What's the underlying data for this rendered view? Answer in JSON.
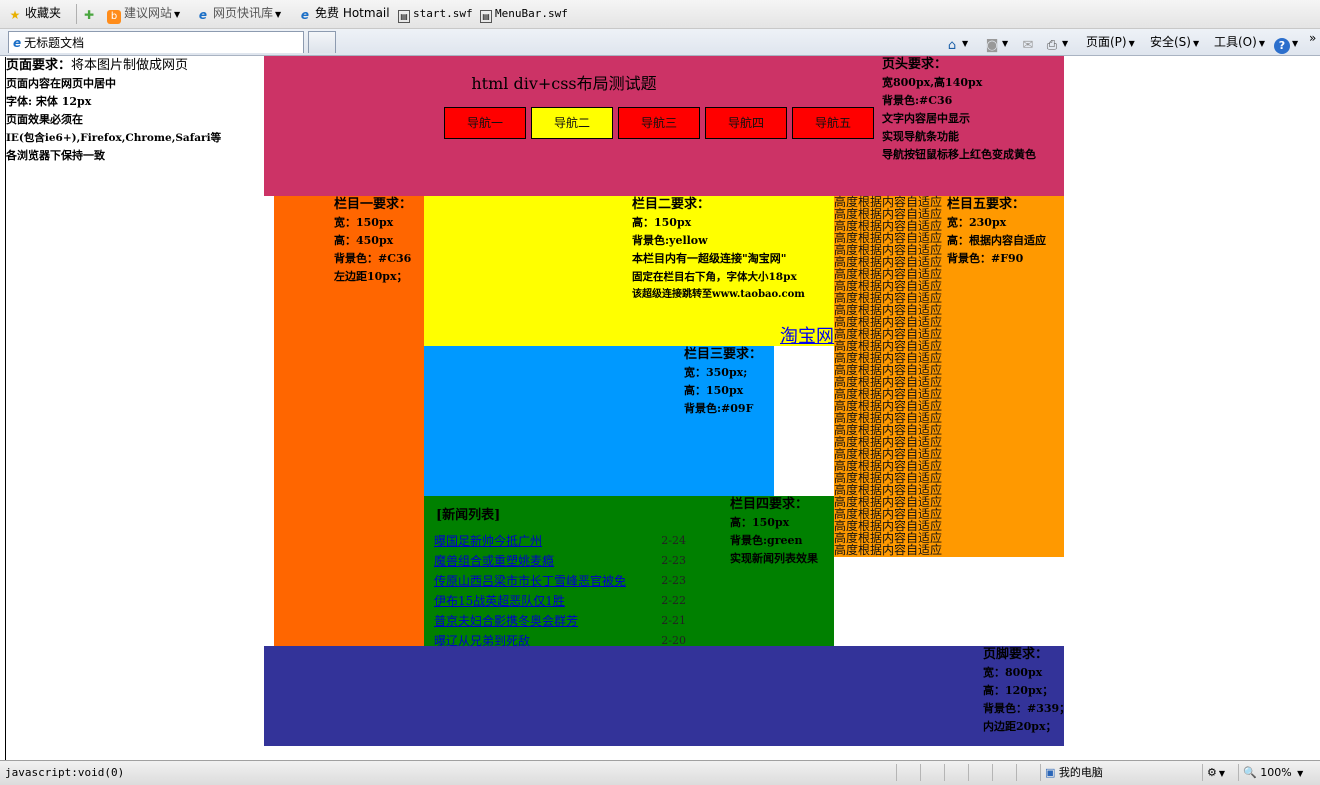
{
  "favorites_bar": {
    "favorites": "收藏夹",
    "suggested_sites": "建议网站",
    "web_slice_gallery": "网页快讯库",
    "hotmail": "免费 Hotmail",
    "start_swf": "start.swf",
    "menubar_swf": "MenuBar.swf"
  },
  "tab": {
    "title": "无标题文档"
  },
  "commands": {
    "page": "页面(P)",
    "safety": "安全(S)",
    "tools": "工具(O)"
  },
  "page_requirements": {
    "title_bold": "页面要求：",
    "title_rest": "将本图片制做成网页",
    "lines": [
      "页面内容在网页中居中",
      "字体: 宋体 12px",
      "页面效果必须在",
      "IE(包含ie6+),Firefox,Chrome,Safari等",
      "各浏览器下保持一致"
    ]
  },
  "header": {
    "site_title": "html div+css布局测试题",
    "nav": [
      "导航一",
      "导航二",
      "导航三",
      "导航四",
      "导航五"
    ],
    "active_nav_index": 1,
    "req_title": "页头要求：",
    "req_lines": [
      "宽800px,高140px",
      "背景色:#C36",
      "文字内容居中显示",
      "实现导航条功能",
      "导航按钮鼠标移上红色变成黄色"
    ]
  },
  "column1": {
    "title": "栏目一要求：",
    "lines": [
      "宽：150px",
      "高：450px",
      "背景色：#C36",
      "左边距10px；"
    ]
  },
  "column2": {
    "title": "栏目二要求：",
    "lines": [
      "高：150px",
      "背景色:yellow",
      "本栏目内有一超级连接\"淘宝网\"",
      "固定在栏目右下角，字体大小18px",
      "该超级连接跳转至www.taobao.com"
    ],
    "link_text": "淘宝网"
  },
  "column3": {
    "title": "栏目三要求：",
    "lines": [
      "宽：350px;",
      "高：150px",
      "背景色:#09F"
    ]
  },
  "column4": {
    "title": "栏目四要求：",
    "lines": [
      "高：150px",
      "背景色:green",
      "实现新闻列表效果"
    ],
    "news_title": "[新闻列表]",
    "news": [
      {
        "title": "曝国足新帅今抵广州",
        "date": "2-24"
      },
      {
        "title": "魔兽组合或重塑姚麦瘾",
        "date": "2-23"
      },
      {
        "title": "传原山西吕梁市市长丁雪峰恶官被免",
        "date": "2-23"
      },
      {
        "title": "伊布15战英超恶队仅1胜",
        "date": "2-22"
      },
      {
        "title": "普京夫妇合影携冬奥会群芳",
        "date": "2-21"
      },
      {
        "title": "曝辽从兄弟到死敌",
        "date": "2-20"
      }
    ]
  },
  "column5": {
    "title": "栏目五要求：",
    "lines": [
      "宽：230px",
      "高：根据内容自适应",
      "背景色：#F90"
    ],
    "filler_text": "高度根据内容自适应",
    "filler_repeat": 30
  },
  "footer": {
    "title": "页脚要求：",
    "lines": [
      "宽：800px",
      "高：120px；",
      "背景色：#339；",
      "内边距20px；"
    ]
  },
  "status": {
    "url": "javascript:void(0)",
    "zone": "我的电脑",
    "zoom": "100%"
  },
  "colors": {
    "header": "#cc3366",
    "column1": "#ff6600",
    "column2": "#ffff00",
    "column3": "#0099ff",
    "column4": "#008000",
    "column5": "#ff9900",
    "footer": "#333399",
    "nav": "#ff0000",
    "nav_hover": "#ffff00"
  }
}
